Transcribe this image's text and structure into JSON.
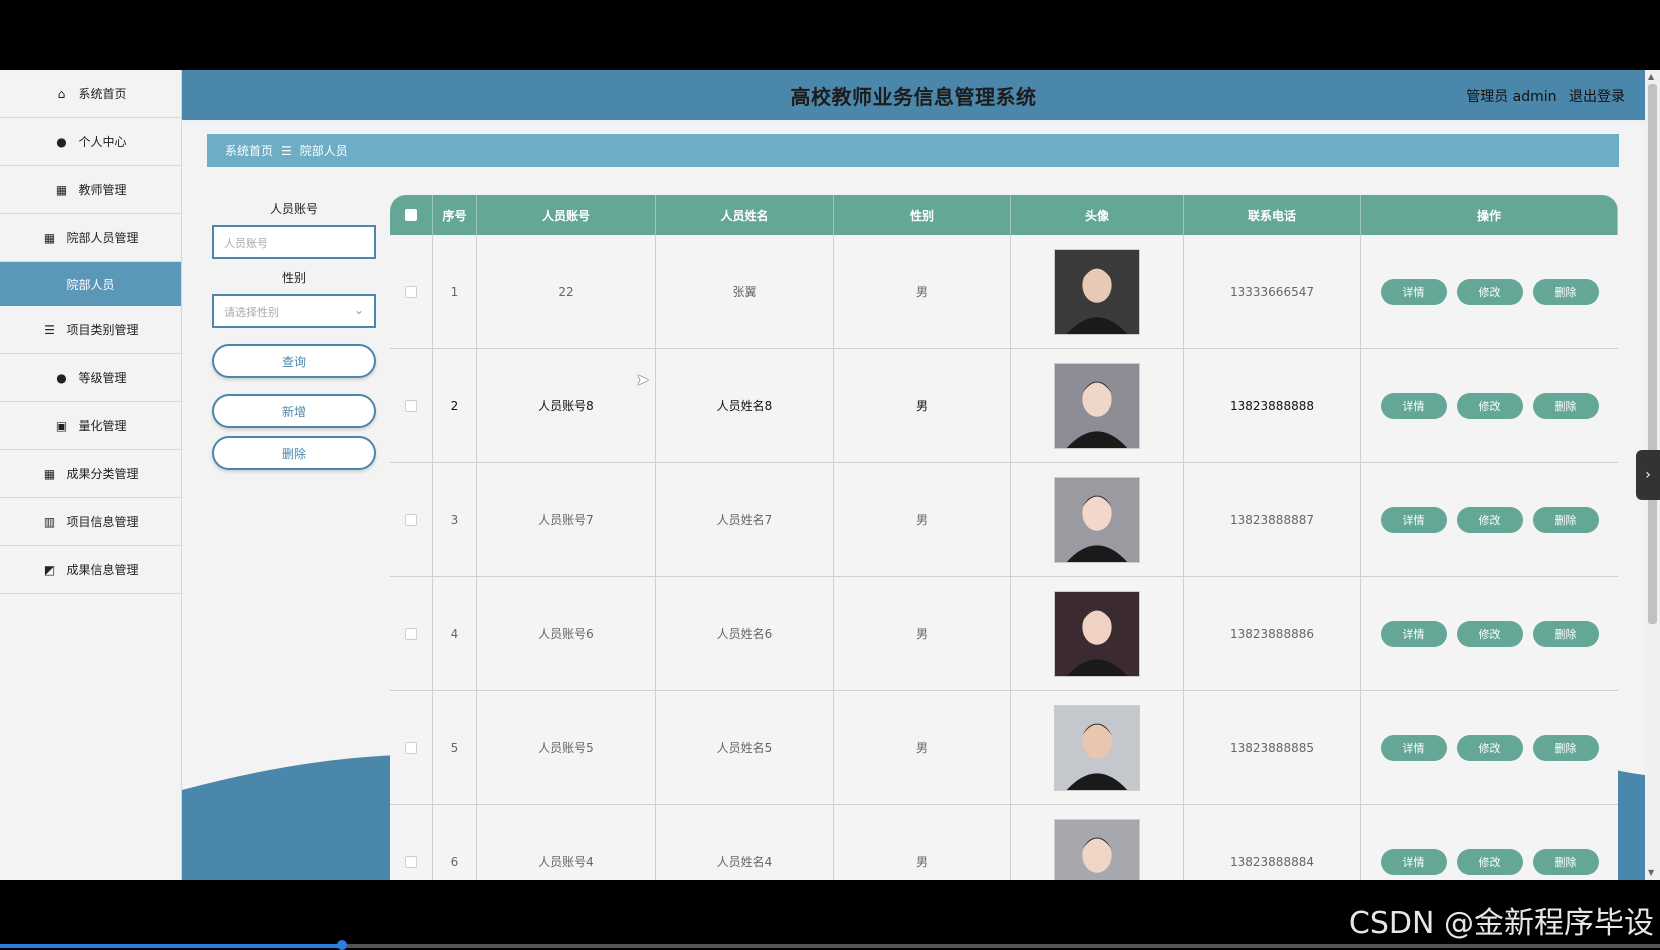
{
  "app_title": "高校教师业务信息管理系统",
  "header": {
    "role": "管理员 admin",
    "logout": "退出登录"
  },
  "sidebar": {
    "items": [
      {
        "label": "系统首页",
        "icon": "home-icon",
        "glyph": "⌂"
      },
      {
        "label": "个人中心",
        "icon": "user-icon",
        "glyph": "●"
      },
      {
        "label": "教师管理",
        "icon": "grid-icon",
        "glyph": "▦"
      },
      {
        "label": "院部人员管理",
        "icon": "grid-icon",
        "glyph": "▦"
      },
      {
        "label": "项目类别管理",
        "icon": "list-icon",
        "glyph": "☰"
      },
      {
        "label": "等级管理",
        "icon": "user-icon",
        "glyph": "●"
      },
      {
        "label": "量化管理",
        "icon": "clipboard-icon",
        "glyph": "▣"
      },
      {
        "label": "成果分类管理",
        "icon": "grid-icon",
        "glyph": "▦"
      },
      {
        "label": "项目信息管理",
        "icon": "bookshelf-icon",
        "glyph": "▥"
      },
      {
        "label": "成果信息管理",
        "icon": "chart-icon",
        "glyph": "◩"
      }
    ],
    "active_sub": "院部人员"
  },
  "breadcrumb": {
    "home": "系统首页",
    "sep": "☰",
    "current": "院部人员"
  },
  "search": {
    "account_label": "人员账号",
    "account_placeholder": "人员账号",
    "gender_label": "性别",
    "gender_placeholder": "请选择性别",
    "query": "查询",
    "add": "新增",
    "delete": "删除"
  },
  "table": {
    "headers": [
      "序号",
      "人员账号",
      "人员姓名",
      "性别",
      "头像",
      "联系电话",
      "操作"
    ],
    "rows": [
      {
        "no": "1",
        "account": "22",
        "name": "张翼",
        "gender": "男",
        "phone": "13333666547",
        "avatar_bg": "#3a3a3a",
        "avatar_fg": "#e8c9b5"
      },
      {
        "no": "2",
        "account": "人员账号8",
        "name": "人员姓名8",
        "gender": "男",
        "phone": "13823888888",
        "avatar_bg": "#8d8d95",
        "avatar_fg": "#f0d6c8"
      },
      {
        "no": "3",
        "account": "人员账号7",
        "name": "人员姓名7",
        "gender": "男",
        "phone": "13823888887",
        "avatar_bg": "#9a9aa0",
        "avatar_fg": "#f2d8cb"
      },
      {
        "no": "4",
        "account": "人员账号6",
        "name": "人员姓名6",
        "gender": "男",
        "phone": "13823888886",
        "avatar_bg": "#3b2a30",
        "avatar_fg": "#f0d2c4"
      },
      {
        "no": "5",
        "account": "人员账号5",
        "name": "人员姓名5",
        "gender": "男",
        "phone": "13823888885",
        "avatar_bg": "#c4c8cc",
        "avatar_fg": "#e8c7ae"
      },
      {
        "no": "6",
        "account": "人员账号4",
        "name": "人员姓名4",
        "gender": "男",
        "phone": "13823888884",
        "avatar_bg": "#a7a8ad",
        "avatar_fg": "#f1d6c8"
      }
    ],
    "actions": {
      "detail": "详情",
      "edit": "修改",
      "delete": "删除"
    }
  },
  "watermark": "CSDN @金新程序毕设",
  "video_progress": 0.206,
  "colors": {
    "header": "#4b87aa",
    "table_head": "#64a796",
    "breadcrumb": "#6eadc6",
    "active_nav": "#5b97b6"
  }
}
